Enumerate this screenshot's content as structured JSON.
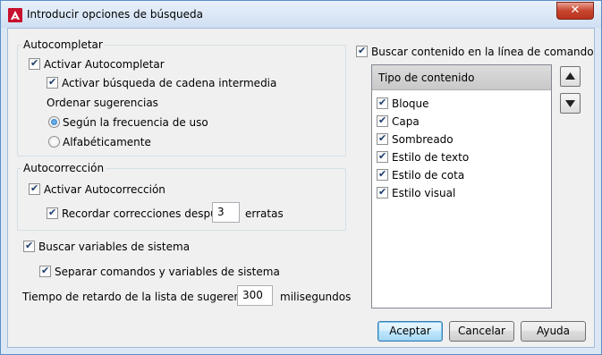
{
  "window": {
    "title": "Introducir opciones de búsqueda",
    "close_glyph": "✕"
  },
  "autocomplete": {
    "legend": "Autocompletar",
    "enable": {
      "label": "Activar Autocompletar",
      "checked": true
    },
    "substring": {
      "label": "Activar búsqueda de cadena intermedia",
      "checked": true
    },
    "sort_label": "Ordenar sugerencias",
    "sort_options": [
      {
        "label": "Según la frecuencia de uso",
        "selected": true
      },
      {
        "label": "Alfabéticamente",
        "selected": false
      }
    ]
  },
  "autocorrect": {
    "legend": "Autocorrección",
    "enable": {
      "label": "Activar Autocorrección",
      "checked": true
    },
    "remember": {
      "label": "Recordar correcciones después",
      "checked": true,
      "value": "3",
      "suffix": "erratas"
    }
  },
  "sysvars": {
    "search": {
      "label": "Buscar variables de sistema",
      "checked": true
    },
    "separate": {
      "label": "Separar comandos y variables de sistema",
      "checked": true
    }
  },
  "delay": {
    "label": "Tiempo de retardo de la lista de sugerencias",
    "value": "300",
    "unit": "milisegundos"
  },
  "content_search": {
    "label": "Buscar contenido en la línea de comando",
    "checked": true
  },
  "content_list": {
    "header": "Tipo de contenido",
    "items": [
      {
        "label": "Bloque",
        "checked": true
      },
      {
        "label": "Capa",
        "checked": true
      },
      {
        "label": "Sombreado",
        "checked": true
      },
      {
        "label": "Estilo de texto",
        "checked": true
      },
      {
        "label": "Estilo de cota",
        "checked": true
      },
      {
        "label": "Estilo visual",
        "checked": true
      }
    ]
  },
  "move_buttons": {
    "up_icon": "triangle-up-icon",
    "down_icon": "triangle-down-icon"
  },
  "buttons": {
    "ok": "Aceptar",
    "cancel": "Cancelar",
    "help": "Ayuda"
  },
  "colors": {
    "accent": "#3c7fb1",
    "app_icon": "#c8102e",
    "close": "#c7452e"
  }
}
